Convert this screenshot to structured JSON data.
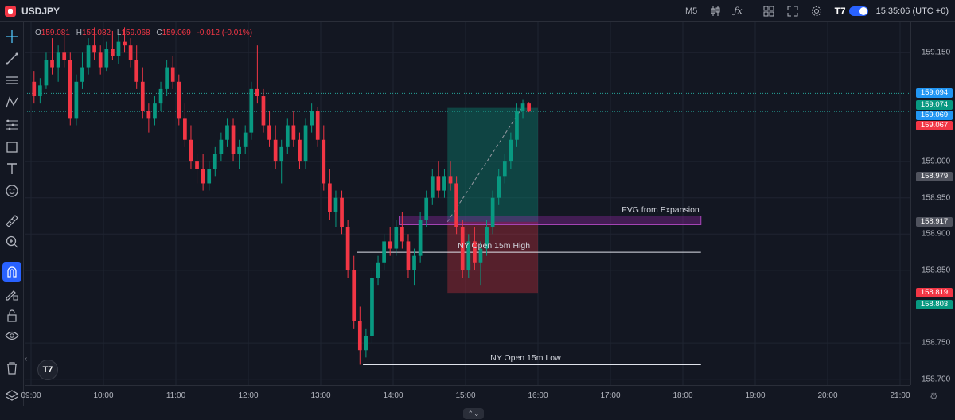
{
  "header": {
    "symbol": "USDJPY",
    "timeframe": "M5",
    "clock": "15:35:06 (UTC +0)"
  },
  "ohlc": {
    "o_label": "O",
    "o": "159.081",
    "h_label": "H",
    "h": "159.082",
    "l_label": "L",
    "l": "159.068",
    "c_label": "C",
    "c": "159.069",
    "change": "-0.012 (-0.01%)"
  },
  "icons": {
    "tools": [
      "crosshair-icon",
      "trend-line-icon",
      "horizontal-lines-icon",
      "pattern-icon",
      "fib-icon",
      "shape-icon",
      "text-icon",
      "emoji-icon",
      "ruler-icon",
      "zoom-icon",
      "magnet-icon",
      "pencil-lock-icon",
      "lock-icon",
      "eye-icon",
      "trash-icon",
      "layers-icon"
    ],
    "top": [
      "candles-icon",
      "fx-icon",
      "layout-icon",
      "fullscreen-icon",
      "gear-icon",
      "tv-logo-icon"
    ]
  },
  "price_axis": {
    "ticks": [
      "159.150",
      "159.000",
      "158.950",
      "158.900",
      "158.850",
      "158.750",
      "158.700"
    ],
    "tick_values": [
      159.15,
      159.0,
      158.95,
      158.9,
      158.85,
      158.75,
      158.7
    ],
    "tags": [
      {
        "label": "159.094",
        "value": 159.094,
        "color": "#2196f3"
      },
      {
        "label": "159.074",
        "value": 159.078,
        "color": "#089981"
      },
      {
        "label": "159.069",
        "value": 159.064,
        "color": "#2196f3"
      },
      {
        "label": "159.067",
        "value": 159.05,
        "color": "#f23645"
      },
      {
        "label": "158.979",
        "value": 158.979,
        "color": "#50535e"
      },
      {
        "label": "158.917",
        "value": 158.917,
        "color": "#50535e"
      },
      {
        "label": "158.819",
        "value": 158.819,
        "color": "#f23645"
      },
      {
        "label": "158.803",
        "value": 158.803,
        "color": "#089981"
      }
    ]
  },
  "time_axis": {
    "labels": [
      "09:00",
      "10:00",
      "11:00",
      "12:00",
      "13:00",
      "14:00",
      "15:00",
      "16:00",
      "17:00",
      "18:00",
      "19:00",
      "20:00",
      "21:00"
    ]
  },
  "annotations": {
    "fvg": "FVG from Expansion",
    "ny_high": "NY Open 15m High",
    "ny_low": "NY Open 15m Low"
  },
  "levels": {
    "fvg_top": 158.925,
    "fvg_bottom": 158.913,
    "ny_high": 158.875,
    "ny_low": 158.72,
    "line_upper": 159.094,
    "line_lower": 159.069
  },
  "position": {
    "entry": 158.917,
    "target": 159.074,
    "stop": 158.819,
    "start_time": "14:45",
    "end_time": "16:00"
  },
  "chart_data": {
    "type": "candlestick",
    "start_time": "09:00",
    "interval_minutes": 5,
    "ylim": [
      158.692,
      159.192
    ],
    "xlim": [
      "09:00",
      "21:00"
    ],
    "colors": {
      "up": "#089981",
      "down": "#f23645"
    },
    "ohlc": [
      [
        159.11,
        159.125,
        159.08,
        159.09
      ],
      [
        159.09,
        159.115,
        159.08,
        159.105
      ],
      [
        159.105,
        159.15,
        159.1,
        159.14
      ],
      [
        159.14,
        159.17,
        159.12,
        159.13
      ],
      [
        159.13,
        159.16,
        159.11,
        159.15
      ],
      [
        159.15,
        159.175,
        159.13,
        159.14
      ],
      [
        159.14,
        159.15,
        159.05,
        159.06
      ],
      [
        159.06,
        159.12,
        159.05,
        159.11
      ],
      [
        159.11,
        159.15,
        159.1,
        159.13
      ],
      [
        159.13,
        159.17,
        159.12,
        159.16
      ],
      [
        159.16,
        159.185,
        159.14,
        159.15
      ],
      [
        159.15,
        159.16,
        159.12,
        159.13
      ],
      [
        159.13,
        159.165,
        159.125,
        159.155
      ],
      [
        159.155,
        159.18,
        159.14,
        159.145
      ],
      [
        159.145,
        159.175,
        159.135,
        159.165
      ],
      [
        159.165,
        159.185,
        159.15,
        159.16
      ],
      [
        159.16,
        159.17,
        159.13,
        159.14
      ],
      [
        159.14,
        159.16,
        159.1,
        159.11
      ],
      [
        159.11,
        159.13,
        159.06,
        159.07
      ],
      [
        159.07,
        159.08,
        159.04,
        159.06
      ],
      [
        159.06,
        159.09,
        159.05,
        159.08
      ],
      [
        159.08,
        159.11,
        159.07,
        159.1
      ],
      [
        159.1,
        159.14,
        159.09,
        159.13
      ],
      [
        159.13,
        159.145,
        159.1,
        159.11
      ],
      [
        159.11,
        159.12,
        159.05,
        159.06
      ],
      [
        159.06,
        159.08,
        159.02,
        159.03
      ],
      [
        159.03,
        159.05,
        158.99,
        159.0
      ],
      [
        159.0,
        159.01,
        158.97,
        158.99
      ],
      [
        158.99,
        159.01,
        158.96,
        158.97
      ],
      [
        158.97,
        159.0,
        158.96,
        158.99
      ],
      [
        158.99,
        159.02,
        158.98,
        159.01
      ],
      [
        159.01,
        159.04,
        159.0,
        159.03
      ],
      [
        159.03,
        159.06,
        159.02,
        159.05
      ],
      [
        159.05,
        159.06,
        159.0,
        159.01
      ],
      [
        159.01,
        159.03,
        158.99,
        159.02
      ],
      [
        159.02,
        159.05,
        159.01,
        159.04
      ],
      [
        159.04,
        159.11,
        159.03,
        159.1
      ],
      [
        159.1,
        159.16,
        159.08,
        159.09
      ],
      [
        159.09,
        159.1,
        159.04,
        159.05
      ],
      [
        159.05,
        159.07,
        159.02,
        159.03
      ],
      [
        159.03,
        159.05,
        158.99,
        159.0
      ],
      [
        159.0,
        159.03,
        158.97,
        159.02
      ],
      [
        159.02,
        159.06,
        159.01,
        159.05
      ],
      [
        159.05,
        159.07,
        159.02,
        159.03
      ],
      [
        159.03,
        159.04,
        158.99,
        159.0
      ],
      [
        159.0,
        159.06,
        158.99,
        159.05
      ],
      [
        159.05,
        159.08,
        159.04,
        159.07
      ],
      [
        159.07,
        159.075,
        159.02,
        159.03
      ],
      [
        159.03,
        159.05,
        158.96,
        158.97
      ],
      [
        158.97,
        158.99,
        158.92,
        158.93
      ],
      [
        158.93,
        158.96,
        158.91,
        158.95
      ],
      [
        158.95,
        158.96,
        158.9,
        158.91
      ],
      [
        158.91,
        158.92,
        158.84,
        158.85
      ],
      [
        158.85,
        158.87,
        158.77,
        158.78
      ],
      [
        158.78,
        158.8,
        158.72,
        158.74
      ],
      [
        158.74,
        158.77,
        158.73,
        158.76
      ],
      [
        158.76,
        158.85,
        158.75,
        158.84
      ],
      [
        158.84,
        158.87,
        158.83,
        158.86
      ],
      [
        158.86,
        158.9,
        158.85,
        158.89
      ],
      [
        158.89,
        158.91,
        158.87,
        158.88
      ],
      [
        158.88,
        158.92,
        158.87,
        158.91
      ],
      [
        158.91,
        158.93,
        158.88,
        158.89
      ],
      [
        158.89,
        158.9,
        158.84,
        158.85
      ],
      [
        158.85,
        158.88,
        158.83,
        158.87
      ],
      [
        158.87,
        158.93,
        158.86,
        158.92
      ],
      [
        158.92,
        158.96,
        158.91,
        158.95
      ],
      [
        158.95,
        158.99,
        158.94,
        158.98
      ],
      [
        158.98,
        159.0,
        158.95,
        158.96
      ],
      [
        158.96,
        158.99,
        158.95,
        158.98
      ],
      [
        158.98,
        159.0,
        158.96,
        158.97
      ],
      [
        158.97,
        158.98,
        158.9,
        158.91
      ],
      [
        158.91,
        158.92,
        158.84,
        158.85
      ],
      [
        158.85,
        158.9,
        158.84,
        158.89
      ],
      [
        158.89,
        158.91,
        158.85,
        158.86
      ],
      [
        158.86,
        158.89,
        158.83,
        158.88
      ],
      [
        158.88,
        158.92,
        158.87,
        158.91
      ],
      [
        158.91,
        158.96,
        158.9,
        158.95
      ],
      [
        158.95,
        158.99,
        158.94,
        158.98
      ],
      [
        158.98,
        159.01,
        158.97,
        159.0
      ],
      [
        159.0,
        159.04,
        158.99,
        159.03
      ],
      [
        159.03,
        159.08,
        159.02,
        159.07
      ],
      [
        159.07,
        159.085,
        159.06,
        159.08
      ],
      [
        159.08,
        159.082,
        159.068,
        159.069
      ]
    ]
  }
}
